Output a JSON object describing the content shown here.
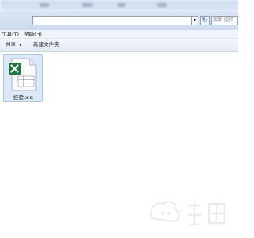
{
  "address_bar": {
    "dropdown_glyph": "▾",
    "refresh_glyph": "↻",
    "search_placeholder": "搜索 经验"
  },
  "menu": {
    "items": [
      "工具(T)",
      "帮助(H)"
    ]
  },
  "commands": {
    "share_label": "共享",
    "share_arrow": "▼",
    "new_folder_label": "新建文件夹"
  },
  "files": [
    {
      "name": "经验.xls",
      "icon": "excel-file-icon"
    }
  ],
  "colors": {
    "toolbar_bg": "#cfdcec",
    "selection_bg": "#dbe9f8",
    "selection_border": "#a9c6e7",
    "excel_green": "#1f7a3a"
  }
}
